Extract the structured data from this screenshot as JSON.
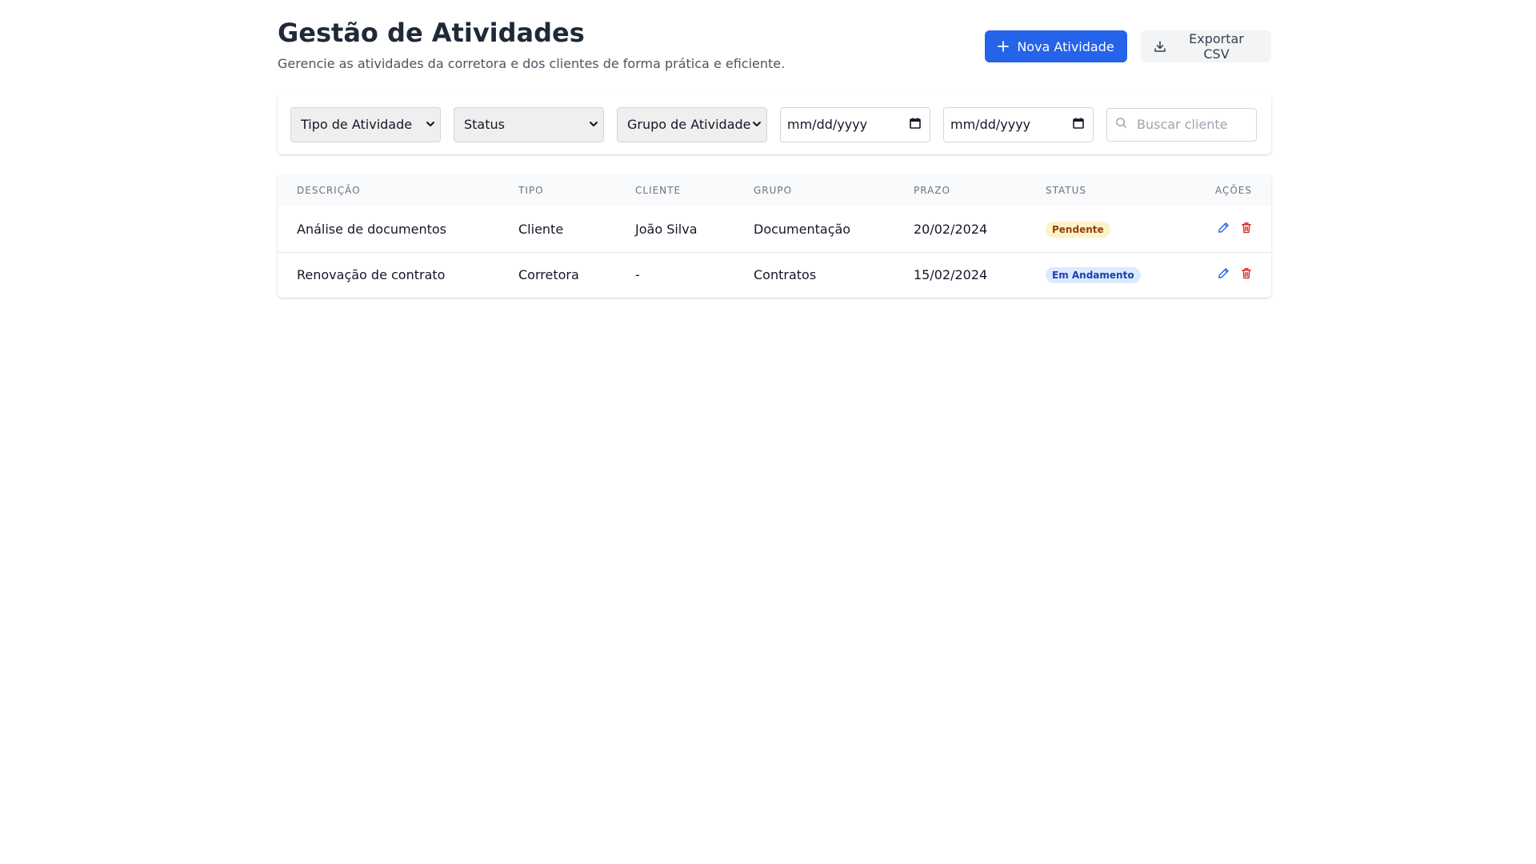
{
  "header": {
    "title": "Gestão de Atividades",
    "subtitle": "Gerencie as atividades da corretora e dos clientes de forma prática e eficiente.",
    "new_button": "Nova Atividade",
    "export_button": "Exportar CSV"
  },
  "filters": {
    "type_select": "Tipo de Atividade",
    "status_select": "Status",
    "group_select": "Grupo de Atividade",
    "date_from": "mm/dd/yyyy",
    "date_to": "mm/dd/yyyy",
    "search_placeholder": "Buscar cliente"
  },
  "table": {
    "columns": [
      "DESCRIÇÃO",
      "TIPO",
      "CLIENTE",
      "GRUPO",
      "PRAZO",
      "STATUS",
      "AÇÕES"
    ],
    "rows": [
      {
        "description": "Análise de documentos",
        "type": "Cliente",
        "client": "João Silva",
        "group": "Documentação",
        "deadline": "20/02/2024",
        "status": "Pendente"
      },
      {
        "description": "Renovação de contrato",
        "type": "Corretora",
        "client": "-",
        "group": "Contratos",
        "deadline": "15/02/2024",
        "status": "Em Andamento"
      }
    ]
  },
  "colors": {
    "primary": "#2563eb",
    "edit_icon": "#2563eb",
    "delete_icon": "#dc2626",
    "pending_bg": "#fef3c7",
    "pending_text": "#92400e",
    "progress_bg": "#dbeafe",
    "progress_text": "#1e40af"
  },
  "icons": {
    "new_button": "plus-icon",
    "export_button": "download-icon",
    "search": "search-icon",
    "date": "calendar-icon",
    "select": "chevron-down-icon",
    "edit": "pencil-icon",
    "delete": "trash-icon"
  }
}
